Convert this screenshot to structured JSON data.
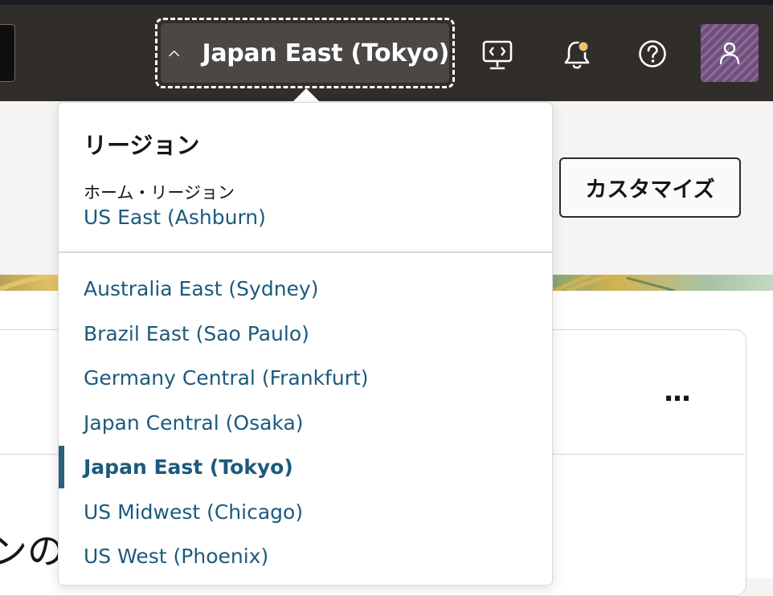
{
  "header": {
    "region_selector": {
      "label": "Japan East (Tokyo)",
      "icon": "chevron-up-icon"
    },
    "icons": [
      "cloud-shell-icon",
      "notification-bell-icon",
      "help-icon",
      "profile-avatar-icon"
    ],
    "notification_dot_color": "#e8c46b"
  },
  "region_panel": {
    "title": "リージョン",
    "home_label": "ホーム・リージョン",
    "home_region": "US East (Ashburn)",
    "regions": [
      "Australia East (Sydney)",
      "Brazil East (Sao Paulo)",
      "Germany Central (Frankfurt)",
      "Japan Central (Osaka)",
      "Japan East (Tokyo)",
      "US Midwest (Chicago)",
      "US West (Phoenix)"
    ],
    "selected_region": "Japan East (Tokyo)"
  },
  "page": {
    "customize_label": "カスタマイズ",
    "more_label": "...",
    "partial_text": "ンの"
  },
  "colors": {
    "header_bg": "#312d2a",
    "link": "#1c5a7d",
    "selected_bar": "#2c5f7f"
  }
}
